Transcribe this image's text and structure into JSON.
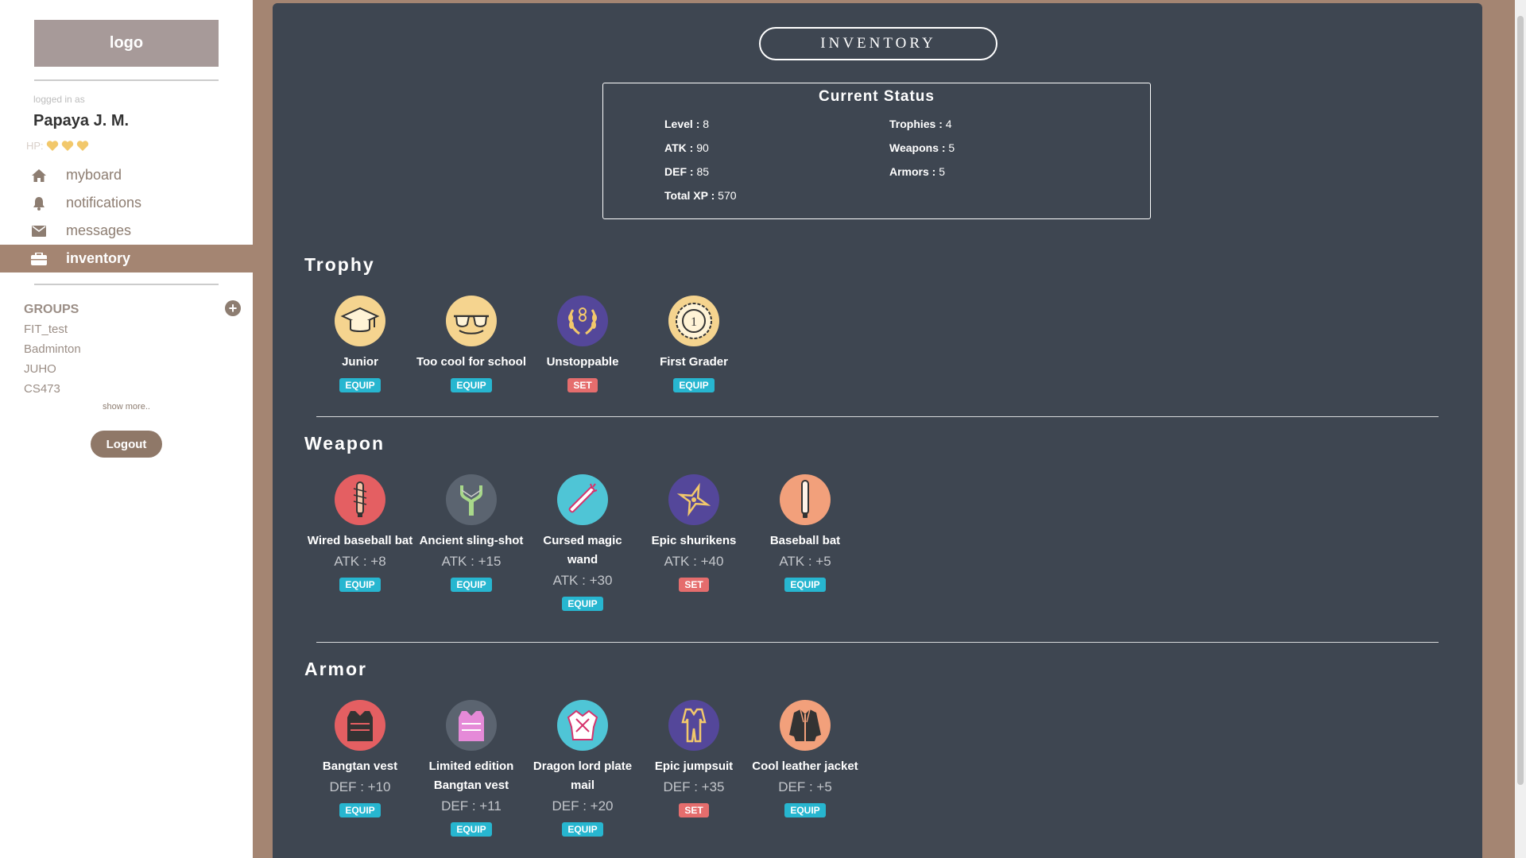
{
  "sidebar": {
    "logo": "logo",
    "logged_in_as": "logged in as",
    "user_name": "Papaya J. M.",
    "hp_label": "HP:",
    "hp_hearts": 3,
    "nav": [
      {
        "label": "myboard",
        "icon": "home-icon"
      },
      {
        "label": "notifications",
        "icon": "bell-icon"
      },
      {
        "label": "messages",
        "icon": "envelope-icon"
      },
      {
        "label": "inventory",
        "icon": "briefcase-icon",
        "active": true
      }
    ],
    "groups_title": "GROUPS",
    "groups": [
      "FIT_test",
      "Badminton",
      "JUHO",
      "CS473"
    ],
    "show_more": "show more..",
    "logout": "Logout"
  },
  "main": {
    "title": "INVENTORY",
    "status": {
      "title": "Current Status",
      "level_label": "Level :",
      "level": "8",
      "atk_label": "ATK :",
      "atk": "90",
      "def_label": "DEF :",
      "def": "85",
      "xp_label": "Total XP :",
      "xp": "570",
      "trophies_label": "Trophies :",
      "trophies": "4",
      "weapons_label": "Weapons :",
      "weapons": "5",
      "armors_label": "Armors :",
      "armors": "5"
    },
    "trophy": {
      "title": "Trophy",
      "items": [
        {
          "name": "Junior",
          "action": "EQUIP",
          "icon": "graduation-cap-icon"
        },
        {
          "name": "Too cool for school",
          "action": "EQUIP",
          "icon": "sunglasses-icon"
        },
        {
          "name": "Unstoppable",
          "action": "SET",
          "icon": "laurel-medal-icon"
        },
        {
          "name": "First Grader",
          "action": "EQUIP",
          "icon": "first-place-badge-icon"
        }
      ]
    },
    "weapon": {
      "title": "Weapon",
      "items": [
        {
          "name": "Wired baseball bat",
          "stat": "ATK : +8",
          "action": "EQUIP",
          "icon": "wired-bat-icon"
        },
        {
          "name": "Ancient sling-shot",
          "stat": "ATK : +15",
          "action": "EQUIP",
          "icon": "slingshot-icon"
        },
        {
          "name": "Cursed magic wand",
          "stat": "ATK : +30",
          "action": "EQUIP",
          "icon": "magic-wand-icon"
        },
        {
          "name": "Epic shurikens",
          "stat": "ATK : +40",
          "action": "SET",
          "icon": "shuriken-icon"
        },
        {
          "name": "Baseball bat",
          "stat": "ATK : +5",
          "action": "EQUIP",
          "icon": "baseball-bat-icon"
        }
      ]
    },
    "armor": {
      "title": "Armor",
      "items": [
        {
          "name": "Bangtan vest",
          "stat": "DEF : +10",
          "action": "EQUIP",
          "icon": "vest-icon"
        },
        {
          "name": "Limited edition Bangtan vest",
          "stat": "DEF : +11",
          "action": "EQUIP",
          "icon": "vest-pink-icon"
        },
        {
          "name": "Dragon lord plate mail",
          "stat": "DEF : +20",
          "action": "EQUIP",
          "icon": "plate-mail-icon"
        },
        {
          "name": "Epic jumpsuit",
          "stat": "DEF : +35",
          "action": "SET",
          "icon": "jumpsuit-icon"
        },
        {
          "name": "Cool leather jacket",
          "stat": "DEF : +5",
          "action": "EQUIP",
          "icon": "leather-jacket-icon"
        }
      ]
    }
  },
  "colors": {
    "sidebar_active": "#a48572",
    "main_bg": "#3e4651",
    "equip": "#27b6d0",
    "set": "#e56d6d",
    "heart": "#f2c86b"
  }
}
